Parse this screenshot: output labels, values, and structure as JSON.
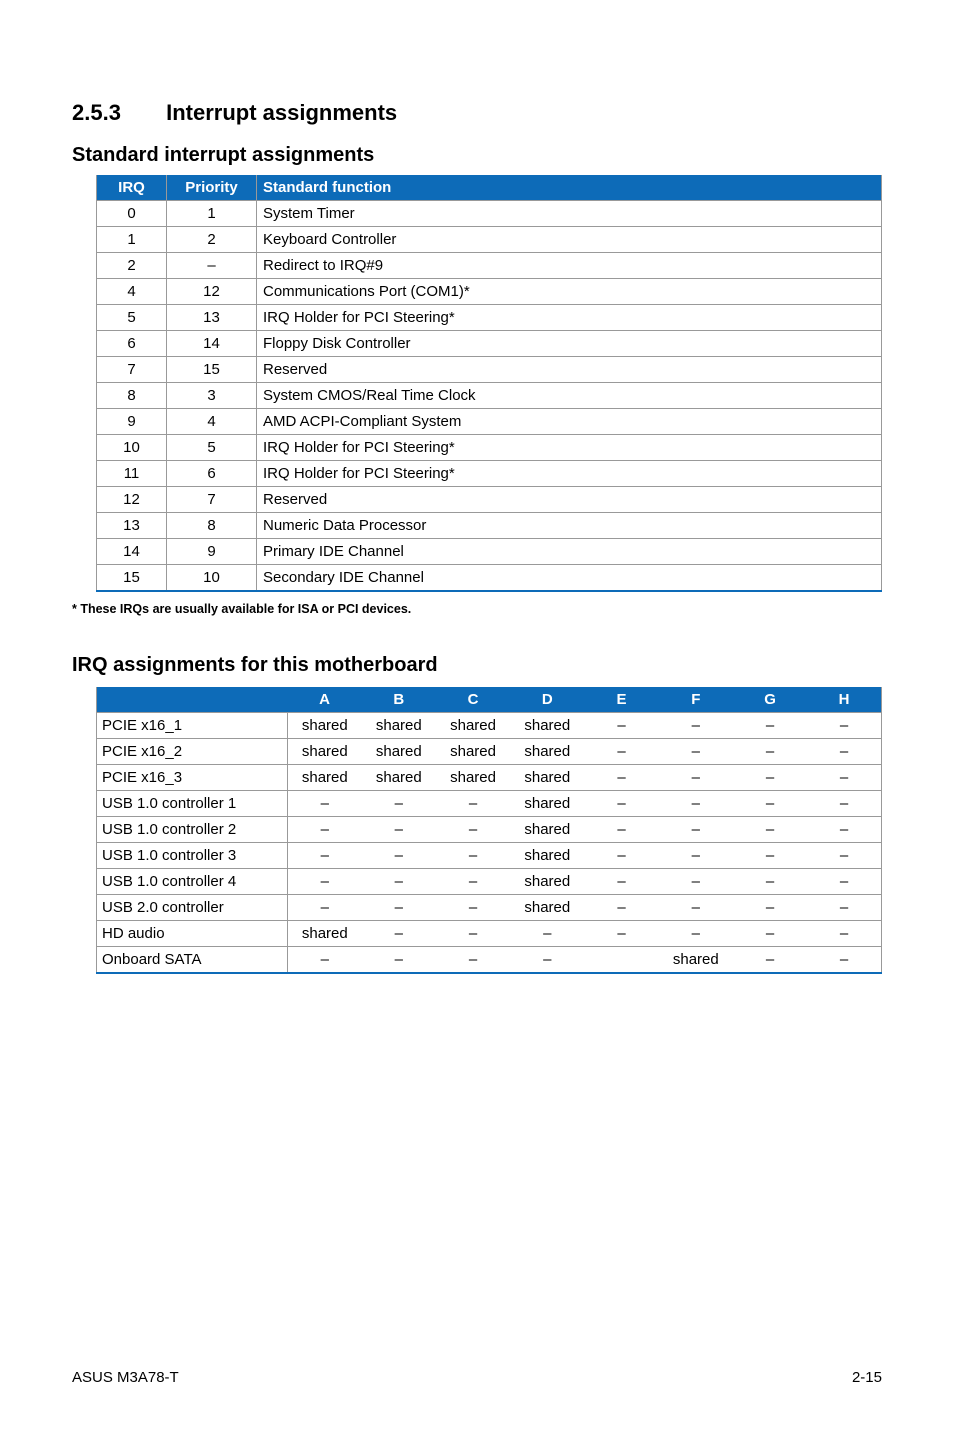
{
  "section": {
    "number": "2.5.3",
    "title": "Interrupt assignments"
  },
  "standard": {
    "heading": "Standard interrupt assignments",
    "headers": {
      "irq": "IRQ",
      "priority": "Priority",
      "func": "Standard function"
    },
    "rows": [
      {
        "irq": "0",
        "priority": "1",
        "func": "System Timer"
      },
      {
        "irq": "1",
        "priority": "2",
        "func": "Keyboard Controller"
      },
      {
        "irq": "2",
        "priority": "–",
        "func": "Redirect to IRQ#9"
      },
      {
        "irq": "4",
        "priority": "12",
        "func": "Communications Port (COM1)*"
      },
      {
        "irq": "5",
        "priority": "13",
        "func": "IRQ Holder for PCI Steering*"
      },
      {
        "irq": "6",
        "priority": "14",
        "func": "Floppy Disk Controller"
      },
      {
        "irq": "7",
        "priority": "15",
        "func": "Reserved"
      },
      {
        "irq": "8",
        "priority": "3",
        "func": "System CMOS/Real Time Clock"
      },
      {
        "irq": "9",
        "priority": "4",
        "func": "AMD ACPI-Compliant System"
      },
      {
        "irq": "10",
        "priority": "5",
        "func": "IRQ Holder for PCI Steering*"
      },
      {
        "irq": "11",
        "priority": "6",
        "func": "IRQ Holder for PCI Steering*"
      },
      {
        "irq": "12",
        "priority": "7",
        "func": "Reserved"
      },
      {
        "irq": "13",
        "priority": "8",
        "func": "Numeric Data Processor"
      },
      {
        "irq": "14",
        "priority": "9",
        "func": "Primary IDE Channel"
      },
      {
        "irq": "15",
        "priority": "10",
        "func": "Secondary IDE Channel"
      }
    ]
  },
  "footnote": "* These IRQs are usually available for ISA or PCI devices.",
  "assignments": {
    "heading": "IRQ assignments for this motherboard",
    "columns": [
      "A",
      "B",
      "C",
      "D",
      "E",
      "F",
      "G",
      "H"
    ],
    "rows": [
      {
        "label": "PCIE x16_1",
        "cells": [
          "shared",
          "shared",
          "shared",
          "shared",
          "–",
          "–",
          "–",
          "–"
        ]
      },
      {
        "label": "PCIE x16_2",
        "cells": [
          "shared",
          "shared",
          "shared",
          "shared",
          "–",
          "–",
          "–",
          "–"
        ]
      },
      {
        "label": "PCIE x16_3",
        "cells": [
          "shared",
          "shared",
          "shared",
          "shared",
          "–",
          "–",
          "–",
          "–"
        ]
      },
      {
        "label": "USB 1.0 controller 1",
        "cells": [
          "–",
          "–",
          "–",
          "shared",
          "–",
          "–",
          "–",
          "–"
        ]
      },
      {
        "label": "USB 1.0 controller 2",
        "cells": [
          "–",
          "–",
          "–",
          "shared",
          "–",
          "–",
          "–",
          "–"
        ]
      },
      {
        "label": "USB 1.0 controller 3",
        "cells": [
          "–",
          "–",
          "–",
          "shared",
          "–",
          "–",
          "–",
          "–"
        ]
      },
      {
        "label": "USB 1.0 controller 4",
        "cells": [
          "–",
          "–",
          "–",
          "shared",
          "–",
          "–",
          "–",
          "–"
        ]
      },
      {
        "label": "USB 2.0 controller",
        "cells": [
          "–",
          "–",
          "–",
          "shared",
          "–",
          "–",
          "–",
          "–"
        ]
      },
      {
        "label": "HD audio",
        "cells": [
          "shared",
          "–",
          "–",
          "–",
          "–",
          "–",
          "–",
          "–"
        ]
      },
      {
        "label": "Onboard SATA",
        "cells": [
          "–",
          "–",
          "–",
          "–",
          "",
          "shared",
          "–",
          "–"
        ]
      }
    ]
  },
  "footer": {
    "left": "ASUS M3A78-T",
    "right": "2-15"
  }
}
